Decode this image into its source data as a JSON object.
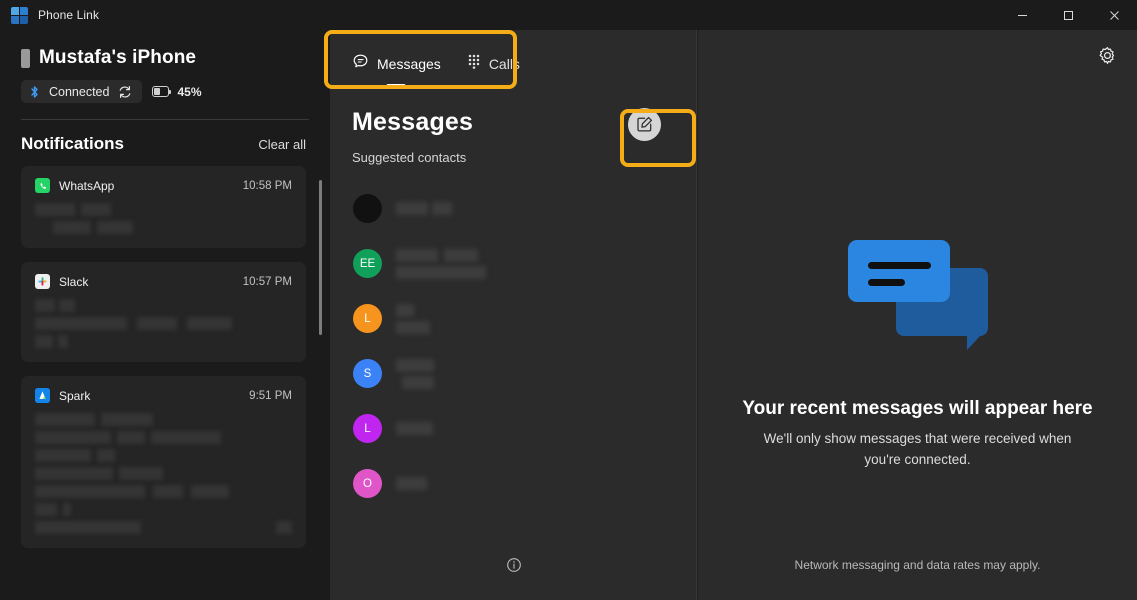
{
  "window": {
    "app_title": "Phone Link",
    "logo_icon": "phone-link-logo",
    "controls": [
      {
        "name": "minimize",
        "icon": "minimize-icon"
      },
      {
        "name": "maximize",
        "icon": "maximize-icon"
      },
      {
        "name": "close",
        "icon": "close-icon"
      }
    ]
  },
  "device": {
    "name": "Mustafa's iPhone",
    "phone_icon": "phone-icon",
    "bluetooth_icon": "bluetooth-icon",
    "status": "Connected",
    "refresh_icon": "refresh-icon",
    "battery_icon": "battery-icon",
    "battery": "45%"
  },
  "notifications": {
    "title": "Notifications",
    "clear_all": "Clear all",
    "items": [
      {
        "app": "WhatsApp",
        "icon": "whatsapp-icon",
        "time": "10:58 PM",
        "body_redacted": true,
        "body_lines": [
          [
            {
              "w": 40
            },
            {
              "w": 30
            }
          ],
          [
            {
              "w": 38
            },
            {
              "w": 36
            }
          ]
        ]
      },
      {
        "app": "Slack",
        "icon": "slack-icon",
        "time": "10:57 PM",
        "body_redacted": true,
        "body_lines": [
          [
            {
              "w": 25
            },
            {
              "w": 18
            }
          ],
          [
            {
              "w": 98
            }
          ],
          [
            {
              "w": 22
            },
            {
              "w": 12
            }
          ]
        ]
      },
      {
        "app": "Spark",
        "icon": "spark-icon",
        "time": "9:51 PM",
        "body_redacted": true,
        "body_lines": [
          [
            {
              "w": 60
            }
          ],
          [
            {
              "w": 90
            }
          ],
          [
            {
              "w": 55
            }
          ],
          [
            {
              "w": 78
            }
          ],
          [
            {
              "w": 95
            }
          ],
          [
            {
              "w": 30
            }
          ],
          [
            {
              "w": 50
            },
            {
              "w": 10
            }
          ]
        ]
      }
    ]
  },
  "tabs": [
    {
      "label": "Messages",
      "icon": "message-bubble-icon",
      "active": true
    },
    {
      "label": "Calls",
      "icon": "dialpad-icon",
      "active": false
    }
  ],
  "messages": {
    "title": "Messages",
    "subtitle": "Suggested contacts",
    "compose_icon": "compose-edit-icon",
    "info_icon": "info-circle-icon",
    "contacts": [
      {
        "initials": "",
        "color": "#111111",
        "name_redacted": true,
        "name_lines": [
          [
            {
              "w": 55
            }
          ]
        ]
      },
      {
        "initials": "EE",
        "color": "#11a05a",
        "name_redacted": true,
        "name_lines": [
          [
            {
              "w": 48
            },
            {
              "w": 34
            }
          ],
          [
            {
              "w": 90
            }
          ]
        ]
      },
      {
        "initials": "L",
        "color": "#f7941e",
        "name_redacted": true,
        "name_lines": [
          [
            {
              "w": 24
            }
          ],
          [
            {
              "w": 36
            }
          ]
        ]
      },
      {
        "initials": "S",
        "color": "#3b82f6",
        "name_redacted": true,
        "name_lines": [
          [
            {
              "w": 40
            }
          ],
          [
            {
              "w": 40
            }
          ]
        ]
      },
      {
        "initials": "L",
        "color": "#c026f0",
        "name_redacted": true,
        "name_lines": [
          [
            {
              "w": 38
            }
          ]
        ]
      },
      {
        "initials": "O",
        "color": "#e056c8",
        "name_redacted": true,
        "name_lines": [
          [
            {
              "w": 32
            }
          ]
        ]
      }
    ]
  },
  "right": {
    "settings_icon": "gear-icon",
    "illustration_icon": "chat-bubbles-illustration",
    "empty_title": "Your recent messages will appear here",
    "empty_subtitle": "We'll only show messages that were received when you're connected.",
    "network_note": "Network messaging and data rates may apply."
  },
  "highlights": {
    "accent_color": "#f5ad17",
    "regions": [
      "tab-bar",
      "compose-button"
    ]
  },
  "colors": {
    "window_bg": "#202020",
    "left_panel_bg": "#1b1b1b",
    "panel_bg": "#2b2b2b",
    "card_bg": "#252525",
    "accent_yellow": "#f5ad17",
    "bubble_front": "#2a86e0",
    "bubble_back": "#1f5c9e",
    "bluetooth_blue": "#3f9bf5"
  }
}
